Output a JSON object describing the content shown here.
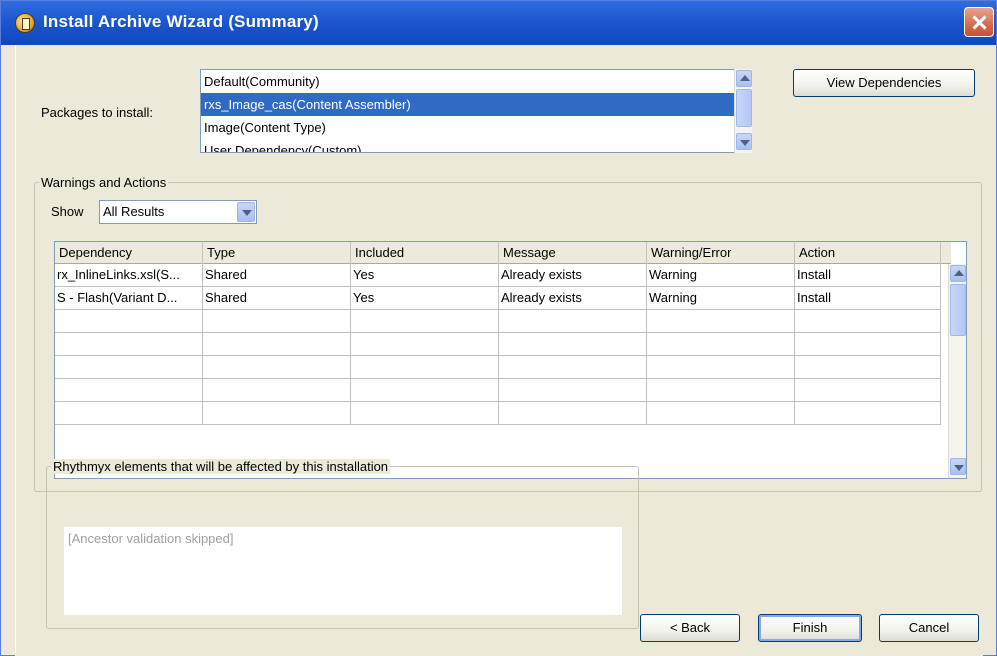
{
  "window": {
    "title": "Install Archive Wizard (Summary)"
  },
  "packages": {
    "label": "Packages to install:",
    "items": [
      "Default(Community)",
      "rxs_Image_cas(Content Assembler)",
      "Image(Content Type)",
      "User Dependency(Custom)"
    ],
    "selected_index": 1,
    "view_dependencies_label": "View Dependencies"
  },
  "warnings": {
    "legend": "Warnings and Actions",
    "show_label": "Show",
    "filter_value": "All Results",
    "columns": [
      "Dependency",
      "Type",
      "Included",
      "Message",
      "Warning/Error",
      "Action"
    ],
    "rows": [
      [
        "rx_InlineLinks.xsl(S...",
        "Shared",
        "Yes",
        "Already exists",
        "Warning",
        "Install"
      ],
      [
        "S - Flash(Variant D...",
        "Shared",
        "Yes",
        "Already exists",
        "Warning",
        "Install"
      ],
      [
        "",
        "",
        "",
        "",
        "",
        ""
      ],
      [
        "",
        "",
        "",
        "",
        "",
        ""
      ],
      [
        "",
        "",
        "",
        "",
        "",
        ""
      ],
      [
        "",
        "",
        "",
        "",
        "",
        ""
      ],
      [
        "",
        "",
        "",
        "",
        "",
        ""
      ]
    ]
  },
  "affected": {
    "legend": "Rhythmyx elements that will be affected by this installation",
    "text": "[Ancestor validation skipped]"
  },
  "footer": {
    "back_label": "< Back",
    "finish_label": "Finish",
    "cancel_label": "Cancel"
  },
  "colors": {
    "titlebar": "#1c57cf",
    "selection": "#316ac5",
    "dialog_background": "#ece9d8"
  },
  "icons": [
    "app-icon",
    "close-icon",
    "chevron-up-icon",
    "chevron-down-icon"
  ]
}
